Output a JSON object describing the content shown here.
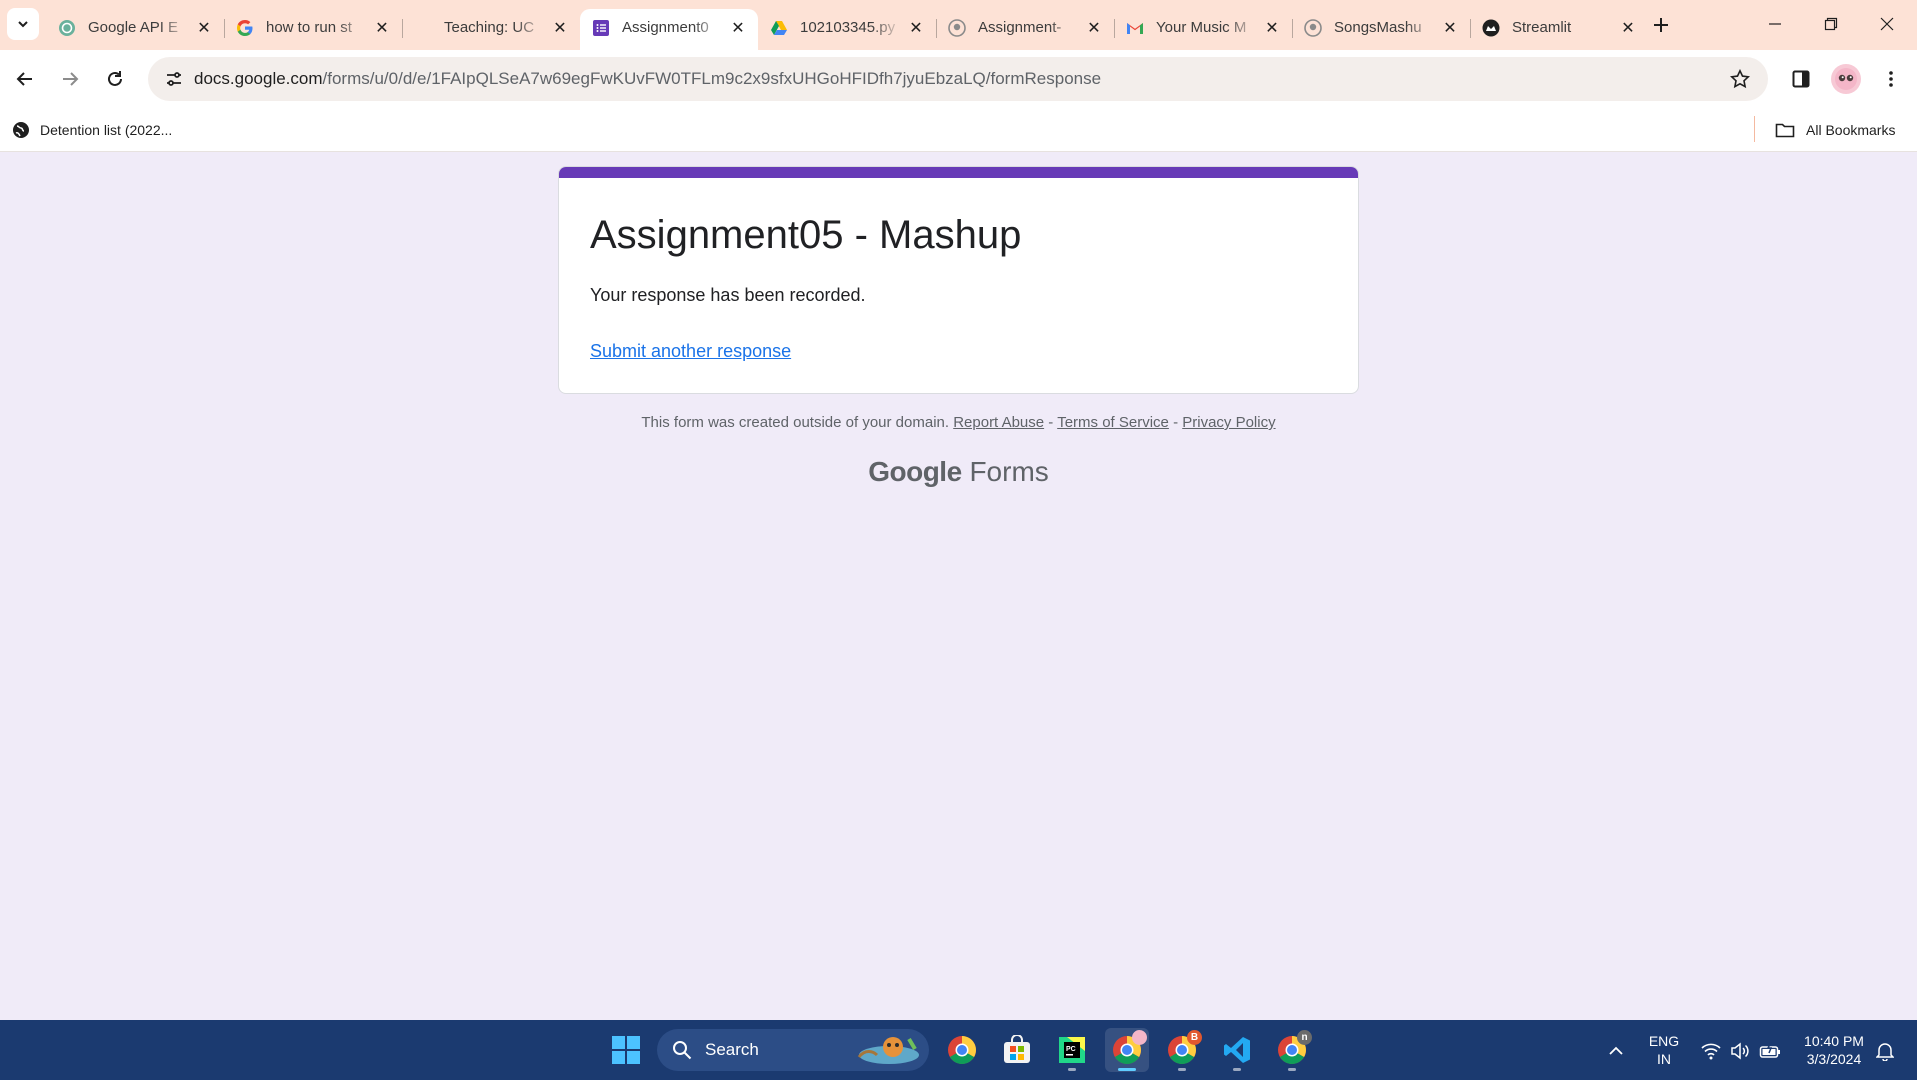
{
  "browser": {
    "tabs": [
      {
        "title": "Google API E",
        "icon": "openai-icon",
        "active": false
      },
      {
        "title": "how to run st",
        "icon": "google-icon",
        "active": false
      },
      {
        "title": "Teaching: UC",
        "icon": "blank-icon",
        "active": false
      },
      {
        "title": "Assignment0",
        "icon": "google-forms-icon",
        "active": true
      },
      {
        "title": "102103345.py",
        "icon": "google-drive-icon",
        "active": false
      },
      {
        "title": "Assignment-",
        "icon": "github-icon",
        "active": false
      },
      {
        "title": "Your Music M",
        "icon": "gmail-icon",
        "active": false
      },
      {
        "title": "SongsMashu",
        "icon": "github-icon",
        "active": false
      },
      {
        "title": "Streamlit",
        "icon": "streamlit-icon",
        "active": false
      }
    ],
    "url": {
      "domain": "docs.google.com",
      "path": "/forms/u/0/d/e/1FAIpQLSeA7w69egFwKUvFW0TFLm9c2x9sfxUHGoHFIDfh7jyuEbzaLQ/formResponse"
    },
    "bookmarks": {
      "item_1": "Detention list (2022...",
      "all_bookmarks": "All Bookmarks"
    }
  },
  "form": {
    "title": "Assignment05 - Mashup",
    "message": "Your response has been recorded.",
    "link": "Submit another response",
    "accent_color": "#673ab7"
  },
  "footer": {
    "notice": "This form was created outside of your domain.",
    "report_abuse": "Report Abuse",
    "sep": "-",
    "terms": "Terms of Service",
    "privacy": "Privacy Policy",
    "brand_google": "Google",
    "brand_forms": "Forms"
  },
  "taskbar": {
    "search_label": "Search",
    "language_top": "ENG",
    "language_bottom": "IN",
    "time": "10:40 PM",
    "date": "3/3/2024",
    "apps": [
      "windows-start-icon",
      "chrome-icon",
      "microsoft-store-icon",
      "pycharm-icon",
      "chrome-profile-icon",
      "chrome-profile-icon",
      "vscode-icon",
      "chrome-profile-icon"
    ],
    "badges": {
      "chrome_2": "B",
      "chrome_3": "n"
    }
  }
}
